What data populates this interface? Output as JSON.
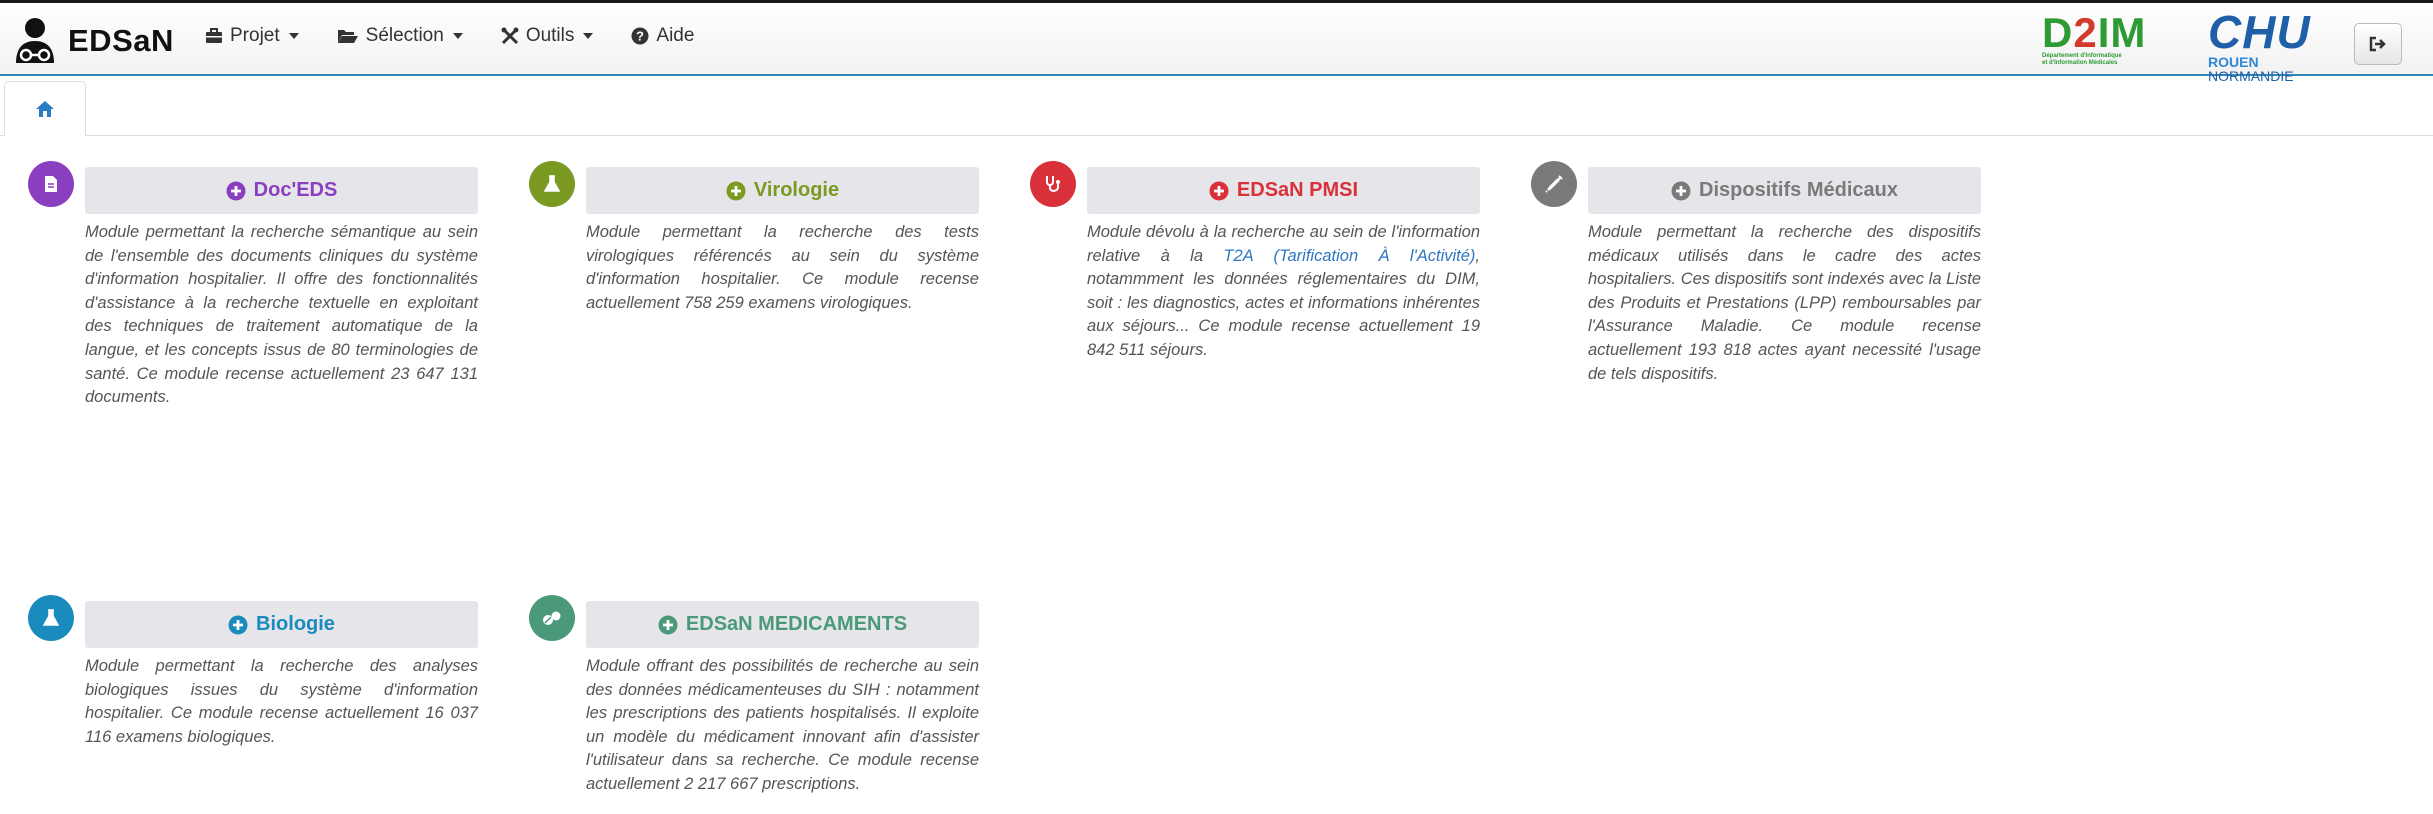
{
  "app": {
    "title": "EDSaN"
  },
  "menu": [
    {
      "label": "Projet",
      "icon": "briefcase-icon"
    },
    {
      "label": "Sélection",
      "icon": "folder-open-icon"
    },
    {
      "label": "Outils",
      "icon": "wrench-icon"
    },
    {
      "label": "Aide",
      "icon": "question-circle-icon"
    }
  ],
  "logos": {
    "d2im": {
      "main_a": "D",
      "main_b": "2",
      "main_c": "IM",
      "sub1": "Département d'Informatique",
      "sub2": "et d'Information Médicales"
    },
    "chu": {
      "main": "CHU",
      "sub_a": "ROUEN",
      "sub_b": " NORMANDIE"
    }
  },
  "tabs": [
    {
      "label": "home",
      "icon": "home-icon"
    }
  ],
  "colors": {
    "docEDS": "#8a3fc0",
    "virologie": "#7a9a22",
    "pmsi": "#d9303a",
    "dispositifs": "#7a7a7a",
    "biologie": "#1a8bbd",
    "medicaments": "#4a9a7a",
    "link": "#2e77c0"
  },
  "modules": {
    "docEDS": {
      "title": "Doc'EDS",
      "icon": "document-icon",
      "desc": "Module permettant la recherche sémantique au sein de l'ensemble des documents cliniques du système d'information hospitalier. Il offre des fonctionnalités d'assistance à la recherche textuelle en exploitant des techniques de traitement automatique de la langue, et les concepts issus de 80 terminologies de santé. Ce module recense actuellement 23 647 131 documents."
    },
    "virologie": {
      "title": "Virologie",
      "icon": "flask-icon",
      "desc": "Module permettant la recherche des tests virologiques référencés au sein du système d'information hospitalier. Ce module recense actuellement 758 259 examens virologiques."
    },
    "pmsi": {
      "title": "EDSaN PMSI",
      "icon": "stethoscope-icon",
      "desc_before": "Module dévolu à la recherche au sein de l'information relative à la ",
      "link": "T2A (Tarification À l'Activité)",
      "desc_after": ", notammment les données réglementaires du DIM, soit : les diagnostics, actes et informations inhérentes aux séjours... Ce module recense actuellement 19 842 511 séjours."
    },
    "dispositifs": {
      "title": "Dispositifs Médicaux",
      "icon": "syringe-icon",
      "desc": "Module permettant la recherche des dispositifs médicaux utilisés dans le cadre des actes hospitaliers. Ces dispositifs sont indexés avec la Liste des Produits et Prestations (LPP) remboursables par l'Assurance Maladie. Ce module recense actuellement 193 818 actes ayant necessité l'usage de tels dispositifs."
    },
    "biologie": {
      "title": "Biologie",
      "icon": "flask-icon",
      "desc": "Module permettant la recherche des analyses biologiques issues du système d'information hospitalier. Ce module recense actuellement 16 037 116 examens biologiques."
    },
    "medicaments": {
      "title": "EDSaN MEDICAMENTS",
      "icon": "pills-icon",
      "desc": "Module offrant des possibilités de recherche au sein des données médicamenteuses du SIH : notamment les prescriptions des patients hospitalisés. Il exploite un modèle du médicament innovant afin d'assister l'utilisateur dans sa recherche. Ce module recense actuellement 2 217 667 prescriptions."
    }
  }
}
